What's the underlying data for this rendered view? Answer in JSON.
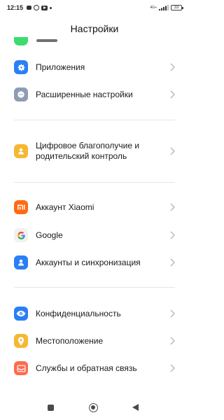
{
  "status_bar": {
    "time": "12:15",
    "network": "4G+",
    "battery": "33"
  },
  "header": {
    "title": "Настройки"
  },
  "settings": {
    "apps": {
      "label": "Приложения",
      "icon": "gear-icon",
      "color": "#2a7ff5"
    },
    "advanced": {
      "label": "Расширенные настройки",
      "icon": "dots-icon",
      "color": "#8d9db3"
    },
    "wellbeing": {
      "label": "Цифровое благополучие и родительский контроль",
      "icon": "person-icon",
      "color": "#f7b733"
    },
    "xiaomi_account": {
      "label": "Аккаунт Xiaomi",
      "icon": "mi-logo-icon",
      "color": "#ff6a13"
    },
    "google": {
      "label": "Google",
      "icon": "google-logo-icon",
      "color": "#f1f1f1"
    },
    "accounts_sync": {
      "label": "Аккаунты и синхронизация",
      "icon": "account-icon",
      "color": "#2a7ff5"
    },
    "privacy": {
      "label": "Конфиденциальность",
      "icon": "eye-icon",
      "color": "#2a7ff5"
    },
    "location": {
      "label": "Местоположение",
      "icon": "location-pin-icon",
      "color": "#f7b733"
    },
    "feedback": {
      "label": "Службы и обратная связь",
      "icon": "feedback-icon",
      "color": "#ff6a4d"
    }
  },
  "nav_bar": {
    "recents": "square-icon",
    "home": "circle-icon",
    "back": "triangle-back-icon"
  }
}
